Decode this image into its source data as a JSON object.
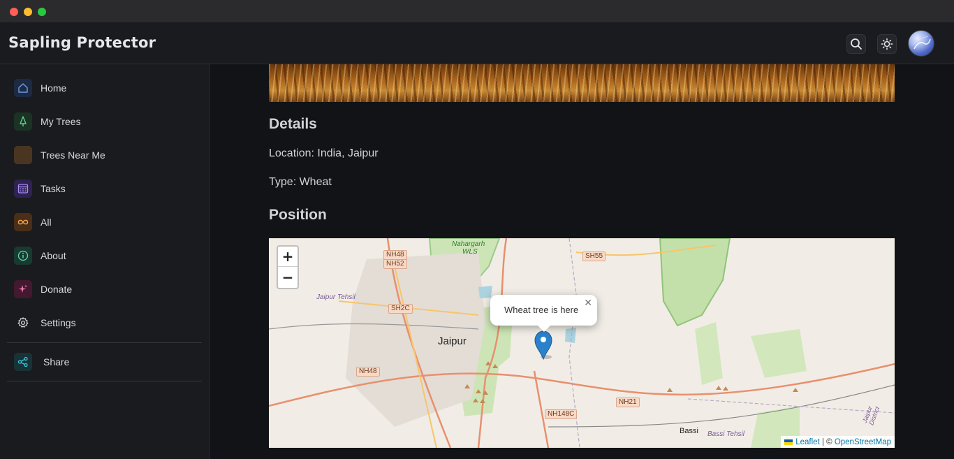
{
  "app": {
    "title": "Sapling Protector"
  },
  "header": {
    "search_icon": "search-icon",
    "theme_icon": "sun-icon"
  },
  "sidebar": {
    "items": [
      {
        "label": "Home",
        "icon": "home-icon",
        "color": "#4b7bd1"
      },
      {
        "label": "My Trees",
        "icon": "tree-icon",
        "color": "#3fae6a"
      },
      {
        "label": "Trees Near Me",
        "icon": "location-icon",
        "color": "#8a5a2b"
      },
      {
        "label": "Tasks",
        "icon": "calendar-icon",
        "color": "#8a6be0"
      },
      {
        "label": "All",
        "icon": "infinity-icon",
        "color": "#e08a2e"
      },
      {
        "label": "About",
        "icon": "info-icon",
        "color": "#3fbf8f"
      },
      {
        "label": "Donate",
        "icon": "sparkle-icon",
        "color": "#e0569a"
      },
      {
        "label": "Settings",
        "icon": "gear-icon",
        "color": "#c9cacf"
      }
    ],
    "share": {
      "label": "Share",
      "icon": "share-icon",
      "color": "#2bb3c9"
    }
  },
  "main": {
    "details_heading": "Details",
    "location_text": "Location: India, Jaipur",
    "type_text": "Type: Wheat",
    "position_heading": "Position"
  },
  "map": {
    "popup_text": "Wheat tree is here",
    "popup_close": "✕",
    "zoom_in": "+",
    "zoom_out": "−",
    "attribution_leaflet": "Leaflet",
    "attribution_sep": " | © ",
    "attribution_osm": "OpenStreetMap",
    "labels": {
      "jaipur": "Jaipur",
      "jaipur_tehsil": "Jaipur Tehsil",
      "nahargarh": "Nahargarh",
      "wls": "WLS",
      "bassi": "Bassi",
      "bassi_tehsil": "Bassi Tehsil",
      "district": "Jaipur District"
    },
    "shields": {
      "nh48_top": "NH48",
      "nh52": "NH52",
      "sh55": "SH55",
      "sh2c": "SH2C",
      "nh48_left": "NH48",
      "nh21": "NH21",
      "nh148c": "NH148C"
    }
  }
}
